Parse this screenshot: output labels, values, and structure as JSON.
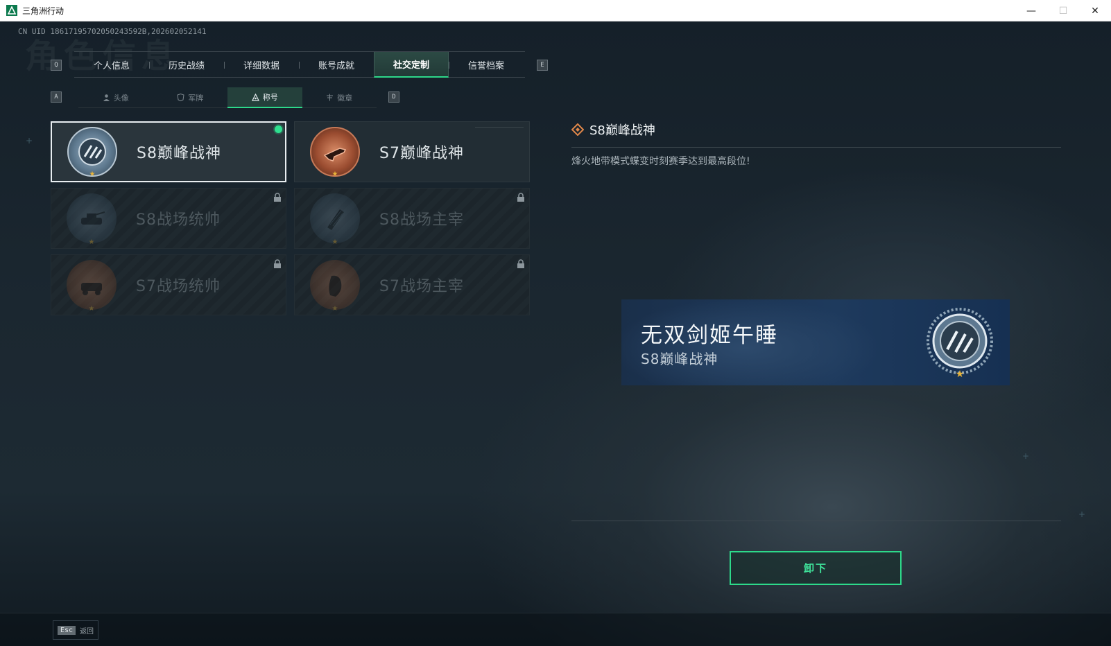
{
  "window": {
    "title": "三角洲行动",
    "minimize": "—",
    "maximize": "☐",
    "close": "✕"
  },
  "uid": "CN UID 18617195702050243592B,202602052141",
  "background_title": "角色信息",
  "tabs": {
    "left_key": "Q",
    "right_key": "E",
    "items": [
      {
        "label": "个人信息"
      },
      {
        "label": "历史战绩"
      },
      {
        "label": "详细数据"
      },
      {
        "label": "账号成就"
      },
      {
        "label": "社交定制"
      },
      {
        "label": "信誉档案"
      }
    ],
    "active_index": 4
  },
  "subtabs": {
    "left_key": "A",
    "right_key": "D",
    "items": [
      {
        "label": "头像",
        "icon": "person-icon"
      },
      {
        "label": "军牌",
        "icon": "badge-icon"
      },
      {
        "label": "称号",
        "icon": "title-icon"
      },
      {
        "label": "徽章",
        "icon": "medal-icon"
      }
    ],
    "active_index": 2
  },
  "titles": [
    {
      "label": "S8巅峰战神",
      "state": "equipped",
      "emblem": "s8-peak-emblem",
      "color": "#6f8ea6"
    },
    {
      "label": "S7巅峰战神",
      "state": "owned",
      "emblem": "s7-peak-emblem",
      "color": "#a25a3e"
    },
    {
      "label": "S8战场统帅",
      "state": "locked",
      "emblem": "s8-commander-emblem",
      "color": "#5b7388"
    },
    {
      "label": "S8战场主宰",
      "state": "locked",
      "emblem": "s8-dominator-emblem",
      "color": "#5b7388"
    },
    {
      "label": "S7战场统帅",
      "state": "locked",
      "emblem": "s7-commander-emblem",
      "color": "#8f5a3d"
    },
    {
      "label": "S7战场主宰",
      "state": "locked",
      "emblem": "s7-dominator-emblem",
      "color": "#8f5a3d"
    }
  ],
  "detail": {
    "title": "S8巅峰战神",
    "description": "烽火地带模式蝶变时刻赛季达到最高段位!"
  },
  "preview": {
    "nickname": "无双剑姬午睡",
    "title": "S8巅峰战神"
  },
  "unequip_button": "卸下",
  "footer": {
    "esc_key": "Esc",
    "back_label": "返回"
  },
  "colors": {
    "accent": "#2dd98a",
    "star": "#e9b53a"
  }
}
